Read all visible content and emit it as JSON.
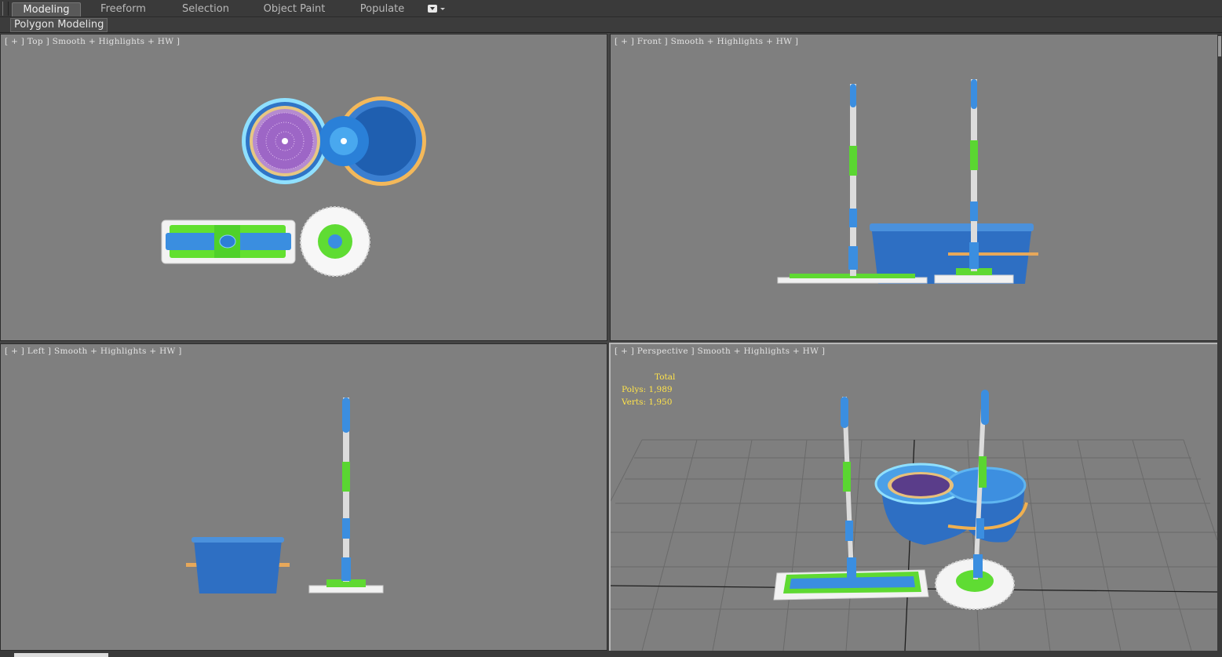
{
  "ribbon": {
    "tabs": [
      {
        "label": "Modeling",
        "active": true
      },
      {
        "label": "Freeform",
        "active": false
      },
      {
        "label": "Selection",
        "active": false
      },
      {
        "label": "Object Paint",
        "active": false
      },
      {
        "label": "Populate",
        "active": false
      }
    ],
    "more_icon": "dropdown-toggle-icon"
  },
  "subpanel": {
    "label": "Polygon Modeling"
  },
  "viewports": {
    "top": {
      "label": "[ + ] Top ] Smooth + Highlights + HW ]"
    },
    "front": {
      "label": "[ + ] Front ] Smooth + Highlights + HW ]"
    },
    "left": {
      "label": "[ + ] Left ] Smooth + Highlights + HW ]"
    },
    "perspective": {
      "label": "[ + ] Perspective ] Smooth + Highlights + HW ]",
      "stats": {
        "title": "Total",
        "polys_label": "Polys:",
        "polys_value": "1,989",
        "verts_label": "Verts:",
        "verts_value": "1,950"
      }
    }
  },
  "colors": {
    "viewport_bg": "#7f7f7f",
    "bucket_blue": "#2f6fc0",
    "handle_blue": "#3b8ee0",
    "mop_green": "#55d93a",
    "accent_orange": "#f0b050",
    "stats_yellow": "#ffe34a"
  }
}
